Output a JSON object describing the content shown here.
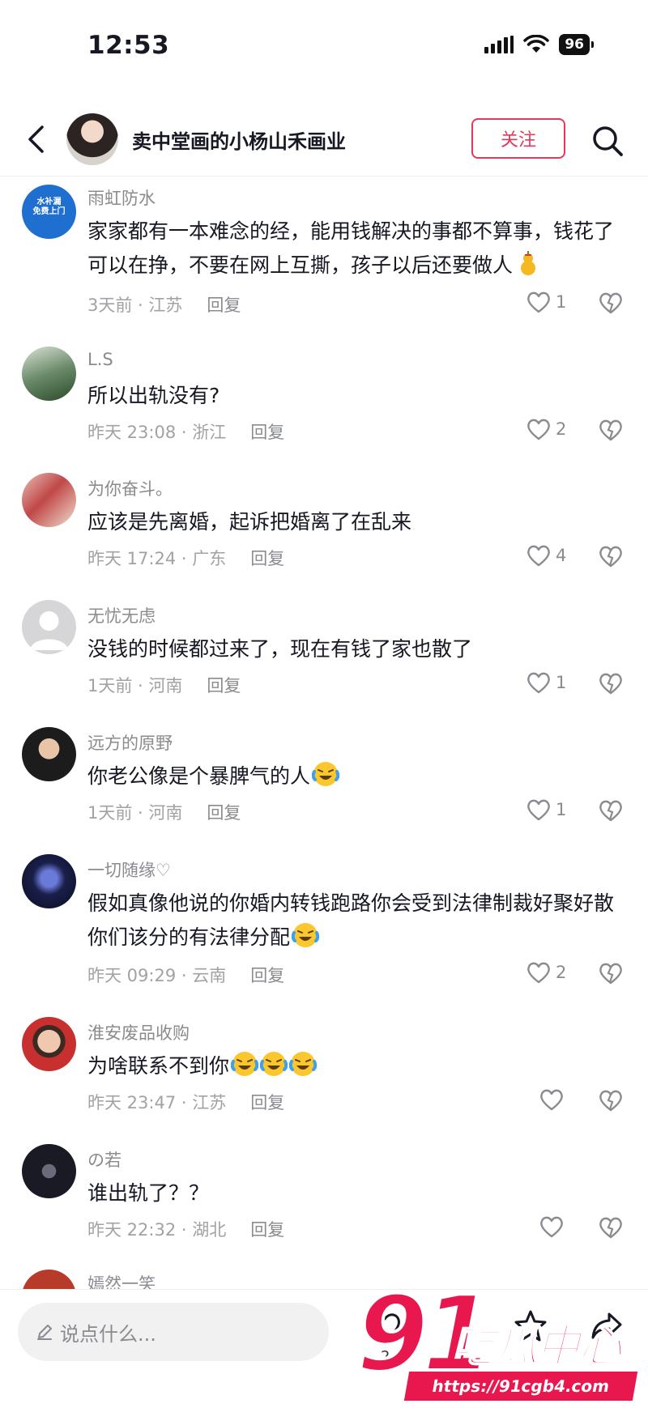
{
  "status_bar": {
    "time": "12:53",
    "battery": "96"
  },
  "header": {
    "title": "卖中堂画的小杨山禾画业",
    "follow_label": "关注"
  },
  "avatar_badge_text": "水补漏\n免费上门",
  "comments": [
    {
      "user": "雨虹防水",
      "text": "家家都有一本难念的经，能用钱解决的事都不算事，钱花了可以在挣，不要在网上互撕，孩子以后还要做人",
      "time_location": "3天前 · 江苏",
      "reply": "回复",
      "likes": "1",
      "emoji": [
        "gourd"
      ]
    },
    {
      "user": "L.S",
      "text": "所以出轨没有?",
      "time_location": "昨天 23:08 · 浙江",
      "reply": "回复",
      "likes": "2",
      "emoji": []
    },
    {
      "user": "为你奋斗。",
      "text": "应该是先离婚，起诉把婚离了在乱来",
      "time_location": "昨天 17:24 · 广东",
      "reply": "回复",
      "likes": "4",
      "emoji": []
    },
    {
      "user": "无忧无虑",
      "text": "没钱的时候都过来了，现在有钱了家也散了",
      "time_location": "1天前 · 河南",
      "reply": "回复",
      "likes": "1",
      "emoji": []
    },
    {
      "user": "远方的原野",
      "text": "你老公像是个暴脾气的人",
      "time_location": "1天前 · 河南",
      "reply": "回复",
      "likes": "1",
      "emoji": [
        "crying-laughing"
      ]
    },
    {
      "user": "一切随缘♡",
      "text": "假如真像他说的你婚内转钱跑路你会受到法律制裁好聚好散你们该分的有法律分配",
      "time_location": "昨天 09:29 · 云南",
      "reply": "回复",
      "likes": "2",
      "emoji": [
        "crying-laughing"
      ]
    },
    {
      "user": "淮安废品收购",
      "text": "为啥联系不到你",
      "time_location": "昨天 23:47 · 江苏",
      "reply": "回复",
      "likes": "",
      "emoji": [
        "crying-laughing",
        "crying-laughing",
        "crying-laughing"
      ]
    },
    {
      "user": "の若",
      "text": "谁出轨了？？",
      "time_location": "昨天 22:32 · 湖北",
      "reply": "回复",
      "likes": "",
      "emoji": []
    },
    {
      "user": "嫣然一笑",
      "text": "",
      "time_location": "",
      "reply": "",
      "likes": "",
      "emoji": []
    }
  ],
  "bottom_bar": {
    "input_placeholder": "说点什么...",
    "like_count": "2"
  },
  "watermark": {
    "brand_number": "91",
    "brand_text": "吃瓜中心",
    "url": "https://91cgb4.com"
  },
  "colors": {
    "accent": "#e23a5a",
    "watermark": "#e8174e",
    "muted_text": "#8a8b91"
  }
}
